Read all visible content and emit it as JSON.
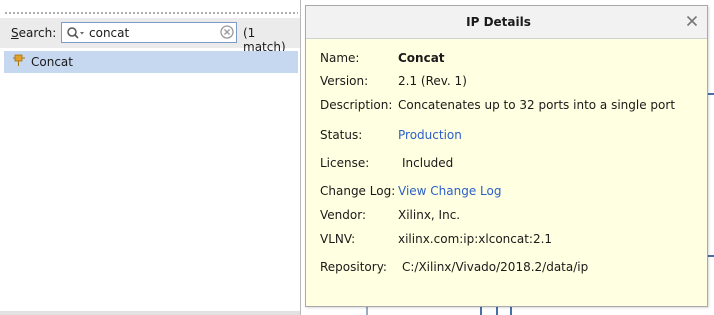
{
  "search": {
    "label": "Search:",
    "label_mnemonic": "S",
    "label_rest": "earch:",
    "value": "concat",
    "match_count": "(1 match)",
    "icon": "search-icon",
    "clear_icon": "clear-icon"
  },
  "results": [
    {
      "label": "Concat",
      "icon": "ip-block-icon",
      "selected": true
    }
  ],
  "ip_details": {
    "title": "IP Details",
    "close_icon": "close-icon",
    "fields": {
      "name": {
        "label": "Name:",
        "value": "Concat"
      },
      "version": {
        "label": "Version:",
        "value": "2.1 (Rev. 1)"
      },
      "description": {
        "label": "Description:",
        "value": "Concatenates up to 32 ports into a single port"
      },
      "status": {
        "label": "Status:",
        "value": "Production"
      },
      "license": {
        "label": "License:",
        "value": "Included"
      },
      "change_log": {
        "label": "Change Log:",
        "value": "View Change Log"
      },
      "vendor": {
        "label": "Vendor:",
        "value": "Xilinx, Inc."
      },
      "vlnv": {
        "label": "VLNV:",
        "value": "xilinx.com:ip:xlconcat:2.1"
      },
      "repository": {
        "label": "Repository:",
        "value": "C:/Xilinx/Vivado/2018.2/data/ip"
      }
    }
  },
  "colors": {
    "popup_background": "#ffffe1",
    "selection": "#c6d8f0",
    "link": "#2b5fc9",
    "ip_icon": "#e0a02a"
  }
}
